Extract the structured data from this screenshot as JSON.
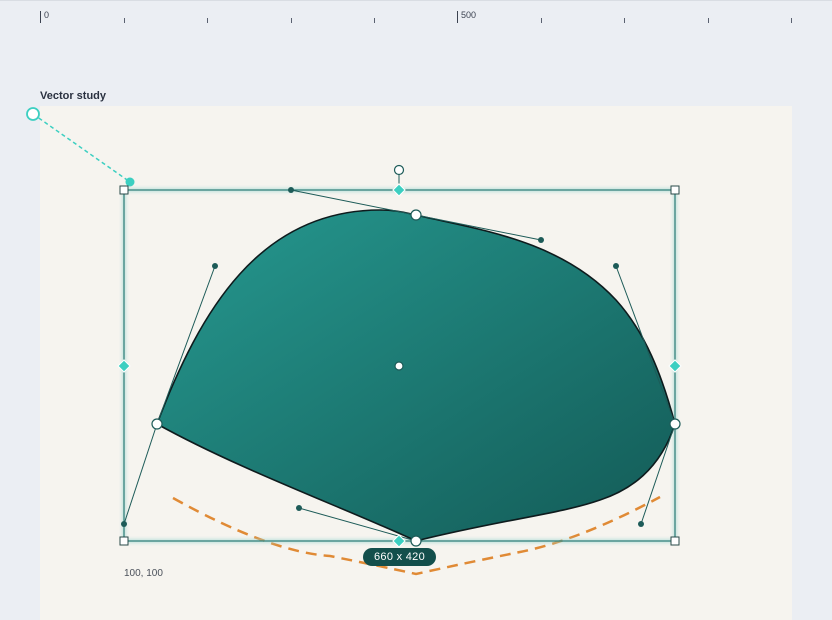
{
  "ruler": {
    "label_0": "0",
    "label_500": "500"
  },
  "frame": {
    "label": "Vector study"
  },
  "selection": {
    "dimensions": "660 x 420",
    "position": "100, 100"
  },
  "colors": {
    "canvas_bg": "#ebeef3",
    "artboard_bg": "#f6f4ef",
    "shape_gradient_start": "#269990",
    "shape_gradient_end": "#135a56",
    "selection_stroke": "#2a7a74",
    "accent": "#3ccfc1",
    "guide_dashed": "#e08a35",
    "badge_bg": "#134f4c"
  },
  "icons": {
    "rotate_handle": "rotate-handle-icon",
    "anchor_point": "anchor-point-icon",
    "bezier_control_point": "control-point-icon",
    "midpoint_diamond": "diamond-handle-icon",
    "corner_handle": "corner-handle-icon"
  }
}
